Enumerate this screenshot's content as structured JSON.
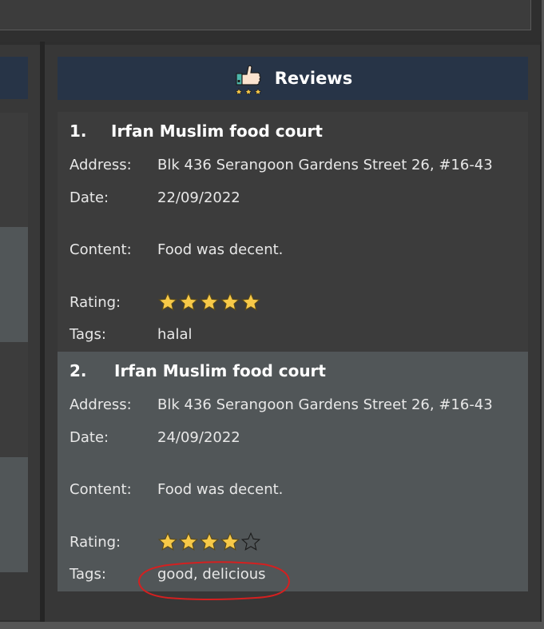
{
  "reviews_panel": {
    "header": {
      "title": "Reviews",
      "icon": "thumbs-up-icon"
    },
    "items": [
      {
        "index": "1.",
        "name": "Irfan Muslim food court",
        "address_label": "Address:",
        "address": "Blk 436 Serangoon Gardens Street 26, #16-43",
        "date_label": "Date:",
        "date": "22/09/2022",
        "content_label": "Content:",
        "content": "Food was decent.",
        "rating_label": "Rating:",
        "rating": 5,
        "rating_max": 5,
        "tags_label": "Tags:",
        "tags": "halal"
      },
      {
        "index": "2.",
        "name": "Irfan Muslim food court",
        "address_label": "Address:",
        "address": "Blk 436 Serangoon Gardens Street 26, #16-43",
        "date_label": "Date:",
        "date": "24/09/2022",
        "content_label": "Content:",
        "content": "Food was decent.",
        "rating_label": "Rating:",
        "rating": 4,
        "rating_max": 5,
        "tags_label": "Tags:",
        "tags": "good, delicious"
      }
    ]
  },
  "colors": {
    "header_bg": "#273447",
    "card_odd_bg": "#3c3c3c",
    "card_even_bg": "#515658",
    "star_fill": "#f7c948",
    "annotation": "#d42020"
  }
}
